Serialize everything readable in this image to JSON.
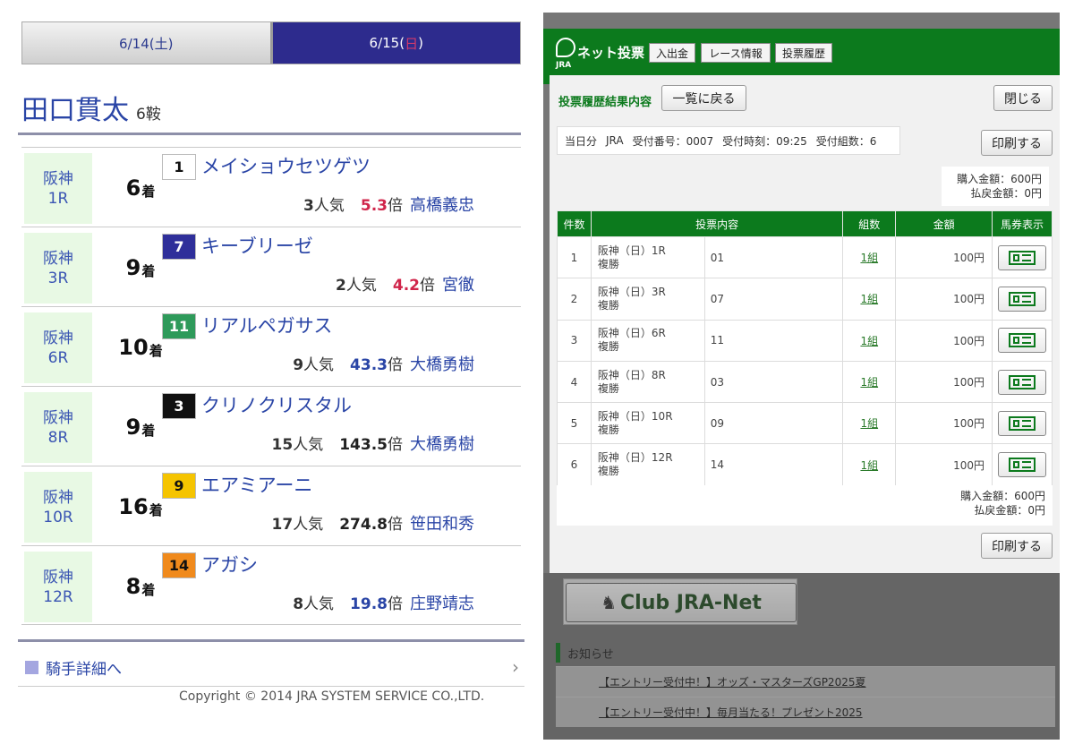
{
  "left": {
    "date_tabs": [
      {
        "label": "6/14(土)",
        "active": false
      },
      {
        "label_prefix": "6/15(",
        "label_day": "日",
        "label_suffix": ")",
        "active": true
      }
    ],
    "jockey": {
      "name": "田口貫太",
      "rides": "6鞍"
    },
    "races": [
      {
        "venue": "阪神",
        "race": "1R",
        "finish_num": "6",
        "finish_unit": "着",
        "gate": "1",
        "gate_bg": "#ffffff",
        "gate_fg": "#111111",
        "horse": "メイショウセツゲツ",
        "pop": "3",
        "pop_unit": "人気",
        "odds": "5.3",
        "odds_unit": "倍",
        "odds_color": "#d0254a",
        "jockey": "高橋義忠"
      },
      {
        "venue": "阪神",
        "race": "3R",
        "finish_num": "9",
        "finish_unit": "着",
        "gate": "7",
        "gate_bg": "#2f2f9a",
        "gate_fg": "#ffffff",
        "horse": "キーブリーゼ",
        "pop": "2",
        "pop_unit": "人気",
        "odds": "4.2",
        "odds_unit": "倍",
        "odds_color": "#d0254a",
        "jockey": "宮徹"
      },
      {
        "venue": "阪神",
        "race": "6R",
        "finish_num": "10",
        "finish_unit": "着",
        "gate": "11",
        "gate_bg": "#2e9a5a",
        "gate_fg": "#ffffff",
        "horse": "リアルペガサス",
        "pop": "9",
        "pop_unit": "人気",
        "odds": "43.3",
        "odds_unit": "倍",
        "odds_color": "#2a45a6",
        "jockey": "大橋勇樹"
      },
      {
        "venue": "阪神",
        "race": "8R",
        "finish_num": "9",
        "finish_unit": "着",
        "gate": "3",
        "gate_bg": "#111111",
        "gate_fg": "#ffffff",
        "horse": "クリノクリスタル",
        "pop": "15",
        "pop_unit": "人気",
        "odds": "143.5",
        "odds_unit": "倍",
        "odds_color": "#222222",
        "jockey": "大橋勇樹"
      },
      {
        "venue": "阪神",
        "race": "10R",
        "finish_num": "16",
        "finish_unit": "着",
        "gate": "9",
        "gate_bg": "#f5c400",
        "gate_fg": "#111111",
        "horse": "エアミアーニ",
        "pop": "17",
        "pop_unit": "人気",
        "odds": "274.8",
        "odds_unit": "倍",
        "odds_color": "#222222",
        "jockey": "笹田和秀"
      },
      {
        "venue": "阪神",
        "race": "12R",
        "finish_num": "8",
        "finish_unit": "着",
        "gate": "14",
        "gate_bg": "#f08a1c",
        "gate_fg": "#111111",
        "horse": "アガシ",
        "pop": "8",
        "pop_unit": "人気",
        "odds": "19.8",
        "odds_unit": "倍",
        "odds_color": "#2a45a6",
        "jockey": "庄野靖志"
      }
    ],
    "detail_link": "騎手詳細へ",
    "copyright": "Copyright © 2014 JRA SYSTEM SERVICE CO.,LTD."
  },
  "right": {
    "logo_text": "ネット投票",
    "logo_sub": "JRA",
    "nav": [
      "入出金",
      "レース情報",
      "投票履歴"
    ],
    "card_title": "投票履歴結果内容",
    "back_button": "一覧に戻る",
    "close_button": "閉じる",
    "print_button": "印刷する",
    "summary": {
      "day": "当日分",
      "org": "JRA",
      "receipt": "受付番号：0007",
      "time": "受付時刻：09:25",
      "sets": "受付組数：6"
    },
    "purchase_amount": "購入金額：600円",
    "refund_amount": "払戻金額：0円",
    "table_headers": [
      "件数",
      "投票内容",
      "組数",
      "金額",
      "馬券表示"
    ],
    "bets": [
      {
        "no": "1",
        "race": "阪神（日）1R",
        "type": "複勝",
        "sel": "01",
        "count": "1組",
        "amount": "100円"
      },
      {
        "no": "2",
        "race": "阪神（日）3R",
        "type": "複勝",
        "sel": "07",
        "count": "1組",
        "amount": "100円"
      },
      {
        "no": "3",
        "race": "阪神（日）6R",
        "type": "複勝",
        "sel": "11",
        "count": "1組",
        "amount": "100円"
      },
      {
        "no": "4",
        "race": "阪神（日）8R",
        "type": "複勝",
        "sel": "03",
        "count": "1組",
        "amount": "100円"
      },
      {
        "no": "5",
        "race": "阪神（日）10R",
        "type": "複勝",
        "sel": "09",
        "count": "1組",
        "amount": "100円"
      },
      {
        "no": "6",
        "race": "阪神（日）12R",
        "type": "複勝",
        "sel": "14",
        "count": "1組",
        "amount": "100円"
      }
    ],
    "club_banner": "Club JRA-Net",
    "notice_title": "お知らせ",
    "notices": [
      "【エントリー受付中！】オッズ・マスターズGP2025夏",
      "【エントリー受付中！】毎月当たる！プレゼント2025"
    ]
  }
}
